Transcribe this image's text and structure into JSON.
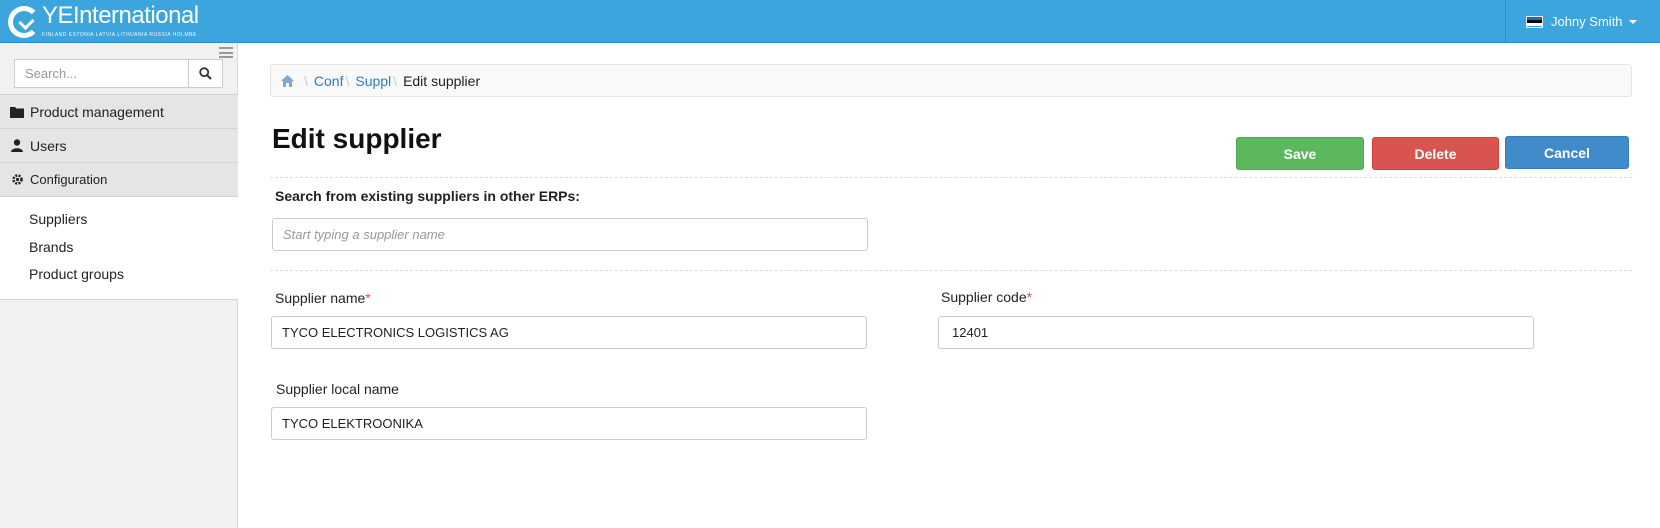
{
  "header": {
    "logo_name": "YEInternational",
    "logo_tagline": "FINLAND  ESTONIA  LATVIA  LITHUANIA  RUSSIA  HOLMBE",
    "user_name": "Johny Smith",
    "flag_colors": [
      "#0072ce",
      "#000000",
      "#ffffff"
    ]
  },
  "sidebar": {
    "search_placeholder": "Search...",
    "menu": [
      {
        "label": "Product management",
        "icon": "folder-icon"
      },
      {
        "label": "Users",
        "icon": "user-icon"
      },
      {
        "label": "Configuration",
        "icon": "gear-icon"
      }
    ],
    "submenu": [
      "Suppliers",
      "Brands",
      "Product groups"
    ]
  },
  "breadcrumb": {
    "home_icon": "home-icon",
    "items": [
      "Conf",
      "Suppl"
    ],
    "current": "Edit supplier"
  },
  "page": {
    "title": "Edit supplier",
    "buttons": {
      "save": "Save",
      "delete": "Delete",
      "cancel": "Cancel"
    }
  },
  "form": {
    "search_label": "Search from existing suppliers in other ERPs:",
    "search_placeholder": "Start typing a supplier name",
    "supplier_name_label": "Supplier name",
    "supplier_name_value": "TYCO ELECTRONICS LOGISTICS AG",
    "supplier_code_label": "Supplier code",
    "supplier_code_value": "12401",
    "supplier_local_name_label": "Supplier local name",
    "supplier_local_name_value": "TYCO ELEKTROONIKA",
    "required_marker": "*"
  },
  "colors": {
    "topbar": "#3ca5dd",
    "save": "#5cb85c",
    "delete": "#d9534f",
    "cancel": "#428bca",
    "link": "#2e7dbd"
  }
}
